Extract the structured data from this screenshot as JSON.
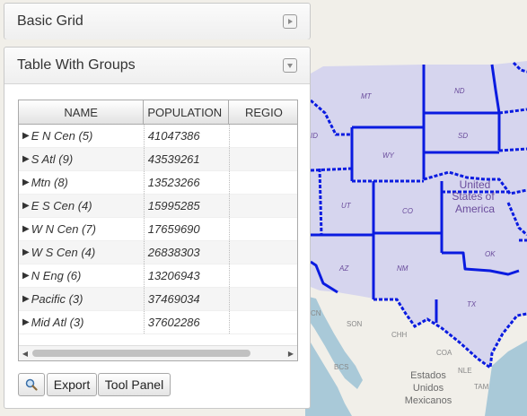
{
  "panels": {
    "basic_grid": {
      "title": "Basic Grid"
    },
    "table_with_groups": {
      "title": "Table With Groups"
    }
  },
  "grid": {
    "columns": [
      "NAME",
      "POPULATION",
      "REGIO"
    ],
    "rows": [
      {
        "name": "E N Cen (5)",
        "population": "41047386"
      },
      {
        "name": "S Atl (9)",
        "population": "43539261"
      },
      {
        "name": "Mtn (8)",
        "population": "13523266"
      },
      {
        "name": "E S Cen (4)",
        "population": "15995285"
      },
      {
        "name": "W N Cen (7)",
        "population": "17659690"
      },
      {
        "name": "W S Cen (4)",
        "population": "26838303"
      },
      {
        "name": "N Eng (6)",
        "population": "13206943"
      },
      {
        "name": "Pacific (3)",
        "population": "37469034"
      },
      {
        "name": "Mid Atl (3)",
        "population": "37602286"
      }
    ]
  },
  "toolbar": {
    "export_label": "Export",
    "tool_panel_label": "Tool Panel",
    "zoom_icon": "magnifier-icon"
  },
  "map": {
    "state_labels": [
      "MT",
      "ND",
      "SD",
      "ID",
      "WY",
      "UT",
      "CO",
      "AZ",
      "NM",
      "OK",
      "TX"
    ],
    "country_label_lines": [
      "United",
      "States of",
      "America"
    ],
    "mexico_labels": [
      "SON",
      "CHH",
      "COA",
      "BCS",
      "NLE",
      "TAM"
    ],
    "mexico_name_lines": [
      "Estados",
      "Unidos",
      "Mexicanos"
    ],
    "cut_label": "CN",
    "colors": {
      "border": "#0a1be0",
      "fill": "#d6d5ee",
      "label": "#6a4c9c",
      "land": "#f1efe9",
      "water": "#a9c9d8"
    }
  }
}
